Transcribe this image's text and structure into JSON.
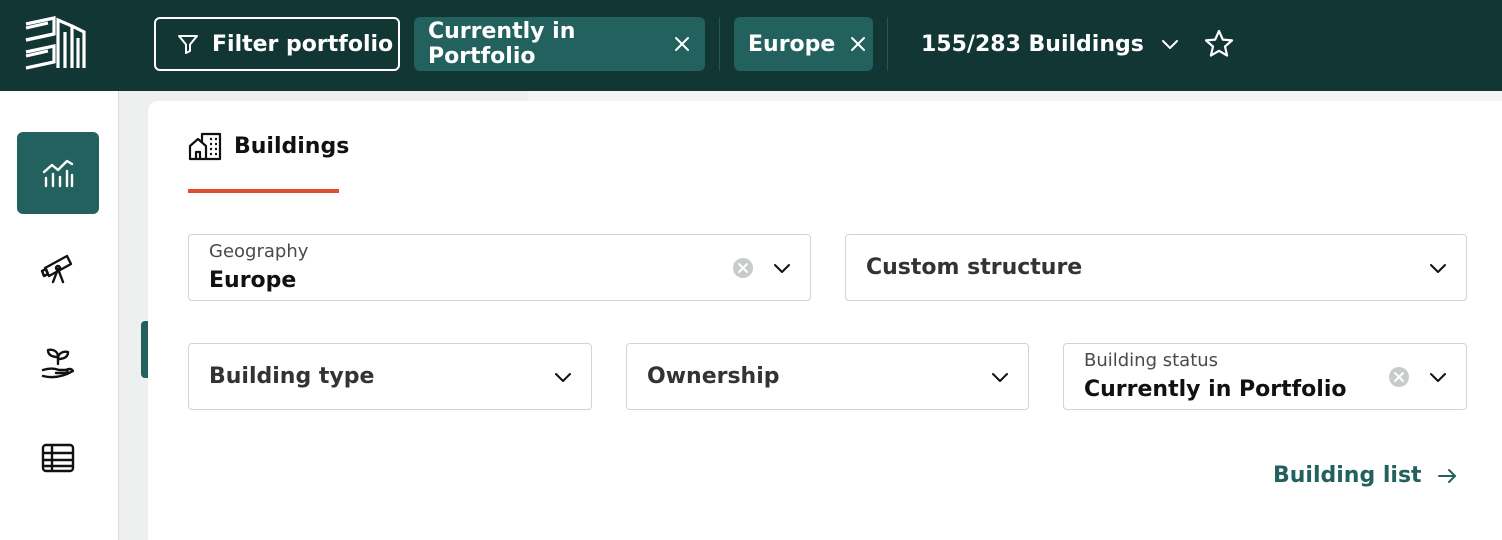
{
  "topbar": {
    "filter_button": "Filter portfolio",
    "chips": [
      {
        "label": "Currently in Portfolio"
      },
      {
        "label": "Europe"
      }
    ],
    "building_count": "155/283 Buildings"
  },
  "tab": {
    "label": "Buildings"
  },
  "filters": {
    "geography": {
      "label": "Geography",
      "value": "Europe"
    },
    "custom_structure": {
      "placeholder": "Custom structure"
    },
    "building_type": {
      "placeholder": "Building type"
    },
    "ownership": {
      "placeholder": "Ownership"
    },
    "building_status": {
      "label": "Building status",
      "value": "Currently in Portfolio"
    }
  },
  "link": {
    "building_list": "Building list"
  },
  "icons": {
    "logo": "brand-logo",
    "filter": "filter-funnel-icon",
    "close": "close-icon",
    "chevron": "chevron-down-icon",
    "star": "star-outline-icon",
    "nav": [
      "analytics-chart-icon",
      "telescope-icon",
      "sprout-hand-icon",
      "table-icon"
    ],
    "tab": "buildings-icon",
    "clear": "clear-circle-icon",
    "arrow": "arrow-right-icon"
  },
  "colors": {
    "topbar": "#113634",
    "accent": "#23615e",
    "tab_underline": "#e14e2e"
  }
}
